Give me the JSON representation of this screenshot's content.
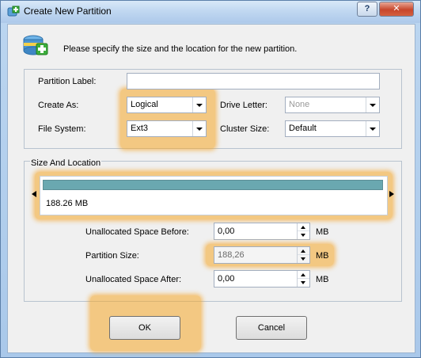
{
  "window": {
    "title": "Create New Partition",
    "help_label": "?",
    "close_label": "✕"
  },
  "header": {
    "instruction": "Please specify the size and the location for the new partition."
  },
  "form": {
    "partition_label": {
      "label": "Partition Label:",
      "value": ""
    },
    "create_as": {
      "label": "Create As:",
      "value": "Logical"
    },
    "drive_letter": {
      "label": "Drive Letter:",
      "value": "None"
    },
    "file_system": {
      "label": "File System:",
      "value": "Ext3"
    },
    "cluster_size": {
      "label": "Cluster Size:",
      "value": "Default"
    }
  },
  "size_location": {
    "group_title": "Size And Location",
    "size_display": "188.26 MB",
    "unallocated_before": {
      "label": "Unallocated Space Before:",
      "value": "0,00",
      "unit": "MB"
    },
    "partition_size": {
      "label": "Partition Size:",
      "value": "188,26",
      "unit": "MB"
    },
    "unallocated_after": {
      "label": "Unallocated Space After:",
      "value": "0,00",
      "unit": "MB"
    }
  },
  "buttons": {
    "ok": "OK",
    "cancel": "Cancel"
  },
  "colors": {
    "highlight": "#f5a828",
    "track": "#6aa8b0"
  }
}
